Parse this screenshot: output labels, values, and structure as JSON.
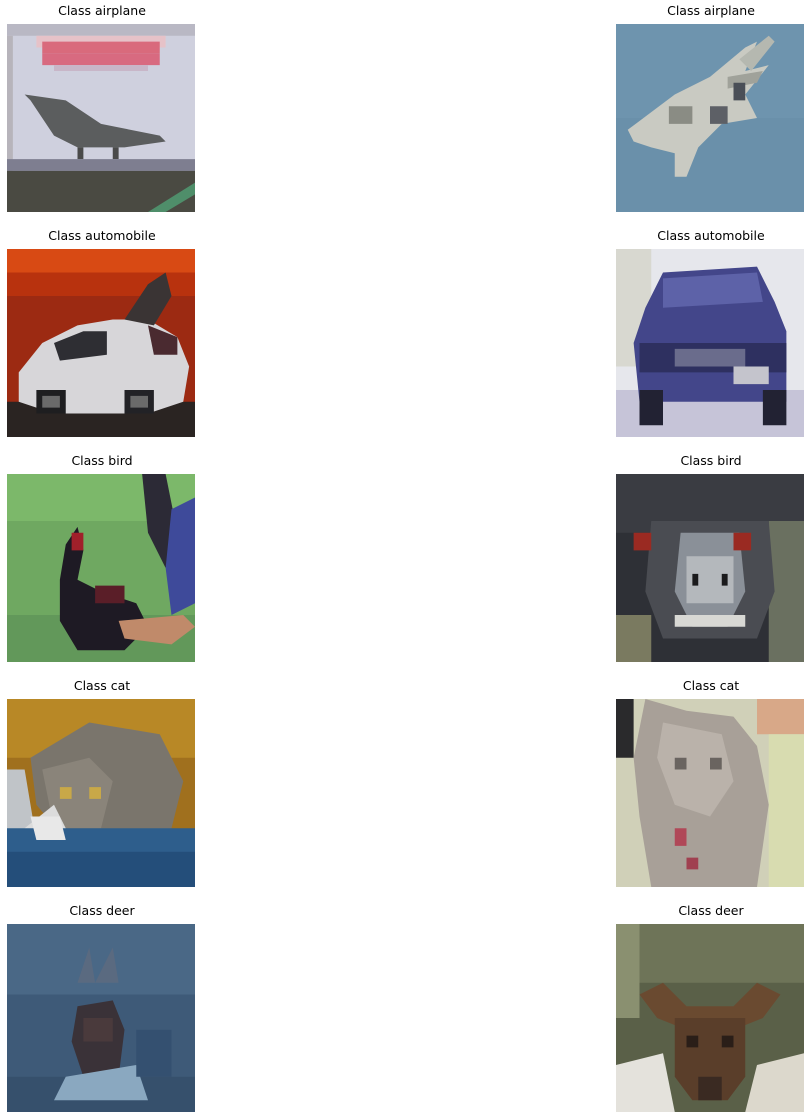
{
  "figure": {
    "panels": [
      {
        "title": "Class airplane"
      },
      {
        "title": "Class airplane"
      },
      {
        "title": "Class automobile"
      },
      {
        "title": "Class automobile"
      },
      {
        "title": "Class bird"
      },
      {
        "title": "Class bird"
      },
      {
        "title": "Class cat"
      },
      {
        "title": "Class cat"
      },
      {
        "title": "Class deer"
      },
      {
        "title": "Class deer"
      }
    ]
  }
}
